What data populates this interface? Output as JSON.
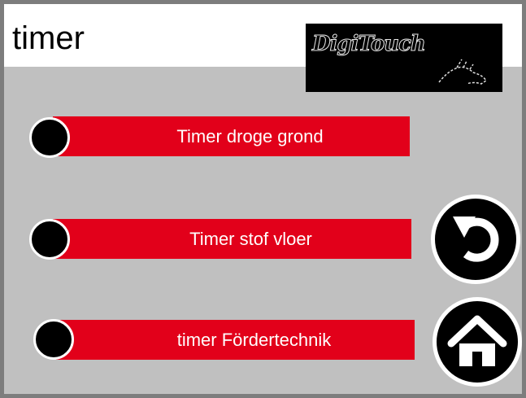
{
  "header": {
    "title": "timer",
    "logo_text": "DigiTouch"
  },
  "rows": [
    {
      "label": "Timer droge grond"
    },
    {
      "label": "Timer stof vloer"
    },
    {
      "label": "timer Fördertechnik"
    }
  ],
  "icons": {
    "back": "undo-arrow-icon",
    "home": "house-icon"
  },
  "colors": {
    "bar": "#e2001a",
    "background": "#c0c0c0",
    "header": "#ffffff"
  }
}
